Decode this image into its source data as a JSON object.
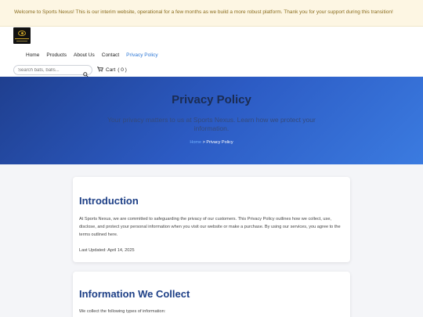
{
  "announcement": "Welcome to Sports Nexus! This is our interim website, operational for a few months as we build a more robust platform. Thank you for your support during this transition!",
  "nav": {
    "items": [
      "Home",
      "Products",
      "About Us",
      "Contact",
      "Privacy Policy"
    ],
    "active": "Privacy Policy"
  },
  "search": {
    "placeholder": "Search bats, balls..."
  },
  "cart": {
    "label": "Cart",
    "count": "( 0 )"
  },
  "hero": {
    "title": "Privacy Policy",
    "subtitle": "Your privacy matters to us at Sports Nexus. Learn how we protect your information.",
    "breadcrumb_home": "Home",
    "breadcrumb_sep": " > ",
    "breadcrumb_current": "Privacy Policy"
  },
  "sections": [
    {
      "heading": "Introduction",
      "body": "At Sports Nexus, we are committed to safeguarding the privacy of our customers. This Privacy Policy outlines how we collect, use, disclose, and protect your personal information when you visit our website or make a purchase. By using our services, you agree to the terms outlined here.",
      "updated": "Last Updated: April 14, 2025"
    },
    {
      "heading": "Information We Collect",
      "body": "We collect the following types of information:"
    }
  ],
  "colors": {
    "accent": "#2e78d6",
    "heading": "#1d3f86",
    "announce_bg": "#fdf6e3",
    "hero_start": "#1f3f8f",
    "hero_end": "#3b7be0"
  },
  "icons": [
    "logo",
    "search-icon",
    "cart-icon"
  ]
}
